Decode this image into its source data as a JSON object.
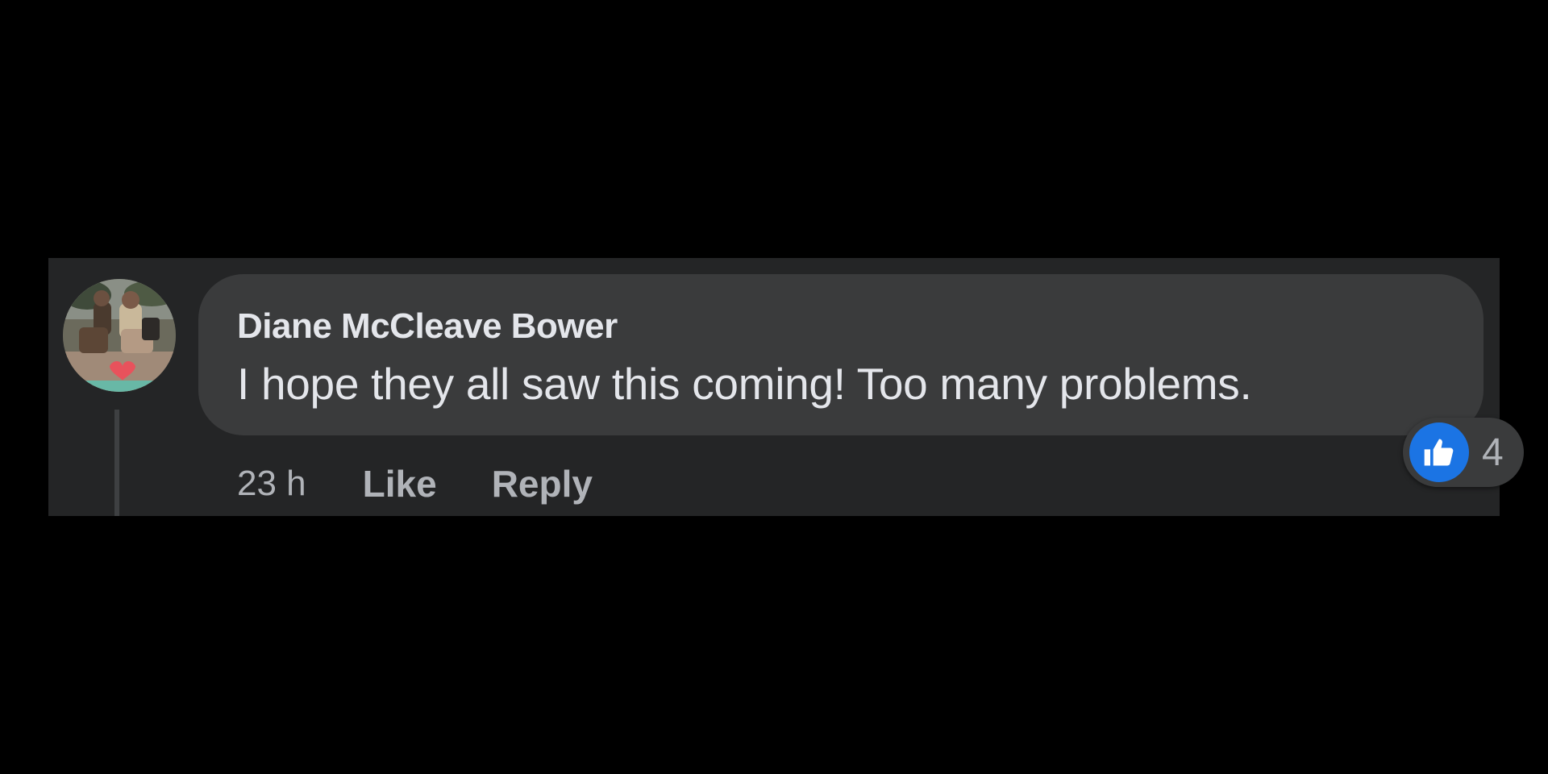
{
  "comment": {
    "author": "Diane McCleave Bower",
    "text": "I hope they all saw this coming! Too many problems.",
    "timestamp": "23 h",
    "like_label": "Like",
    "reply_label": "Reply",
    "reactions": {
      "type_icon": "thumbs-up-icon",
      "count": "4",
      "color": "#1b74e4"
    }
  },
  "colors": {
    "page_background": "#000000",
    "panel_background": "#242526",
    "bubble_background": "#3a3b3c",
    "primary_text": "#e4e6eb",
    "secondary_text": "#b0b3b8"
  }
}
